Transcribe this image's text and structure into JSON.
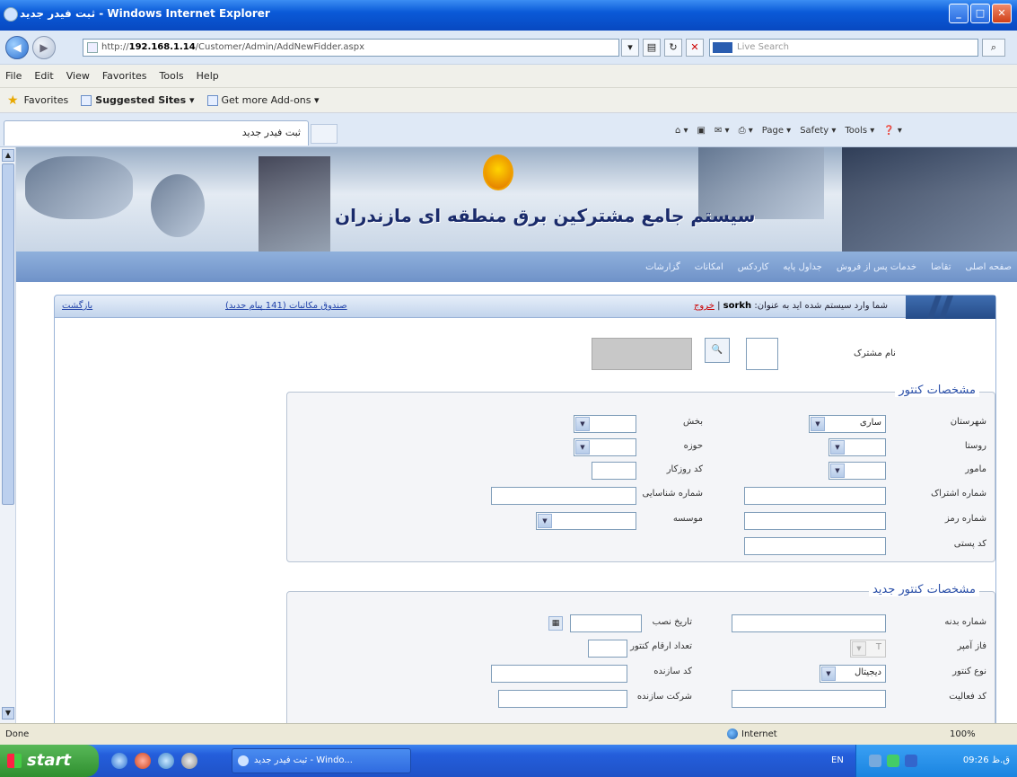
{
  "window": {
    "title": "ثبت فیدر جدید - Windows Internet Explorer",
    "controls": {
      "minimize": "_",
      "maximize": "□",
      "close": "✕"
    }
  },
  "address": {
    "prefix": "http://",
    "host": "192.168.1.14",
    "path": "/Customer/Admin/AddNewFidder.aspx",
    "search_placeholder": "Live Search"
  },
  "menu": [
    "File",
    "Edit",
    "View",
    "Favorites",
    "Tools",
    "Help"
  ],
  "favorites": {
    "label": "Favorites",
    "items": [
      "Suggested Sites ▾",
      "Get more Add-ons ▾"
    ]
  },
  "tab": {
    "label": "ثبت فیدر جدید"
  },
  "commands": [
    "Page ▾",
    "Safety ▾",
    "Tools ▾"
  ],
  "banner": {
    "title": "سیستم جامع مشترکین برق منطقه ای مازندران"
  },
  "nav": [
    "صفحه اصلی",
    "تقاضا",
    "خدمات پس از فروش",
    "جداول پایه",
    "کاردکس",
    "امکانات",
    "گزارشات"
  ],
  "panel": {
    "back": "بازگشت",
    "inbox": "صندوق مکاتبات (141 پیام جدید)",
    "login_text": "شما وارد سیستم شده اید به عنوان:",
    "user": "sorkh",
    "exit": "خروج"
  },
  "customer": {
    "label": "نام مشترک"
  },
  "meter_section": {
    "title": "مشخصات کنتور",
    "fields": {
      "city_label": "شهرستان",
      "city_value": "ساری",
      "part_label": "بخش",
      "village_label": "روستا",
      "zone_label": "حوزه",
      "agent_label": "مامور",
      "daily_code_label": "کد روزکار",
      "subscription_label": "شماره اشتراک",
      "id_label": "شماره شناسایی",
      "password_label": "شماره رمز",
      "institute_label": "موسسه",
      "postal_label": "کد پستی"
    }
  },
  "new_meter_section": {
    "title": "مشخصات کنتور جدید",
    "fields": {
      "body_no_label": "شماره بدنه",
      "install_date_label": "تاریخ نصب",
      "phase_amp_label": "فاز آمپر",
      "phase_amp_value": "T",
      "digits_label": "تعداد ارقام کنتور",
      "meter_type_label": "نوع کنتور",
      "meter_type_value": "دیجیتال",
      "maker_code_label": "کد سازنده",
      "activity_code_label": "کد فعالیت",
      "maker_company_label": "شرکت سازنده"
    }
  },
  "status": {
    "text": "Done",
    "zone": "Internet",
    "zoom": "100%"
  },
  "taskbar": {
    "start": "start",
    "window_item": "ثبت فیدر جدید - Windo...",
    "lang": "EN",
    "clock": "09:26 ق.ظ"
  }
}
